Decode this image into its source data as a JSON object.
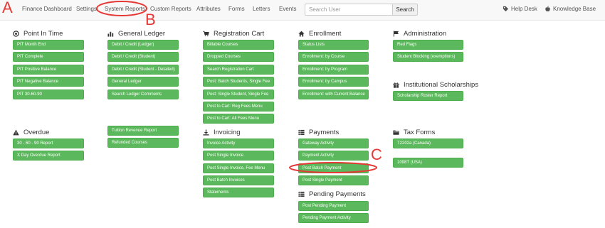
{
  "nav": {
    "items": [
      "Finance Dashboard",
      "Settings",
      "System Reports",
      "Custom Reports",
      "Attributes",
      "Forms",
      "Letters",
      "Events"
    ],
    "search_placeholder": "Search User",
    "search_button": "Search",
    "help_desk": "Help Desk",
    "knowledge_base": "Knowledge Base"
  },
  "sections": {
    "pit": {
      "title": "Point In Time",
      "icon": "target-icon",
      "buttons": [
        "PIT Month End",
        "PIT Complete",
        "PIT Positive Balance",
        "PIT Negative Balance",
        "PIT 30-60-90"
      ]
    },
    "general_ledger": {
      "title": "General Ledger",
      "icon": "bar-chart-icon",
      "buttons": [
        "Debit / Credit (Ledger)",
        "Debit / Credit (Student)",
        "Debit / Credit (Student - Detailed)",
        "General Ledger",
        "Search Ledger Comments"
      ]
    },
    "registration_cart": {
      "title": "Registration Cart",
      "icon": "cart-icon",
      "buttons": [
        "Billable Courses",
        "Dropped Courses",
        "Search Registration Cart",
        "Post: Batch Students, Single Fee",
        "Post: Single Student, Single Fee",
        "Post to Cart: Reg Fees Menu",
        "Post to Cart: All Fees Menu"
      ]
    },
    "enrollment": {
      "title": "Enrollment",
      "icon": "home-icon",
      "buttons": [
        "Status Lists",
        "Enrollment: by Course",
        "Enrollment: by Program",
        "Enrollment: by Campus",
        "Enrollment: with Current Balance"
      ]
    },
    "administration": {
      "title": "Administration",
      "icon": "flag-icon",
      "buttons": [
        "Red Flags",
        "Student Blocking (exemptions)"
      ]
    },
    "institutional_scholarships": {
      "title": "Institutional Scholarships",
      "icon": "gift-icon",
      "buttons": [
        "Scholarship Roster Report"
      ]
    },
    "overdue": {
      "title": "Overdue",
      "icon": "warning-icon",
      "buttons": [
        "30 - 60 - 90 Report",
        "X Day Overdue Report"
      ]
    },
    "tuition": {
      "buttons": [
        "Tuition Revenue Report",
        "Refunded Courses"
      ]
    },
    "invoicing": {
      "title": "Invoicing",
      "icon": "download-icon",
      "buttons": [
        "Invoice Activity",
        "Post Single Invoice",
        "Post Single Invoice, Fee Menu",
        "Post Batch Invoices",
        "Statements"
      ]
    },
    "payments": {
      "title": "Payments",
      "icon": "list-icon",
      "buttons": [
        "Gateway Activity",
        "Payment Activity",
        "Post Batch Payment",
        "Post Single Payment"
      ]
    },
    "pending_payments": {
      "title": "Pending Payments",
      "icon": "list-icon",
      "buttons": [
        "Post Pending Payment",
        "Pending Payment Activity"
      ]
    },
    "tax_forms": {
      "title": "Tax Forms",
      "icon": "folder-icon",
      "buttons": [
        "T2202a (Canada)",
        "1098T (USA)"
      ]
    }
  },
  "annotations": {
    "a": "A",
    "b": "B",
    "c": "C"
  },
  "colors": {
    "button_green": "#5cb85c",
    "annotation_red": "#e53935",
    "navbar_bg": "#f8f8f8"
  }
}
